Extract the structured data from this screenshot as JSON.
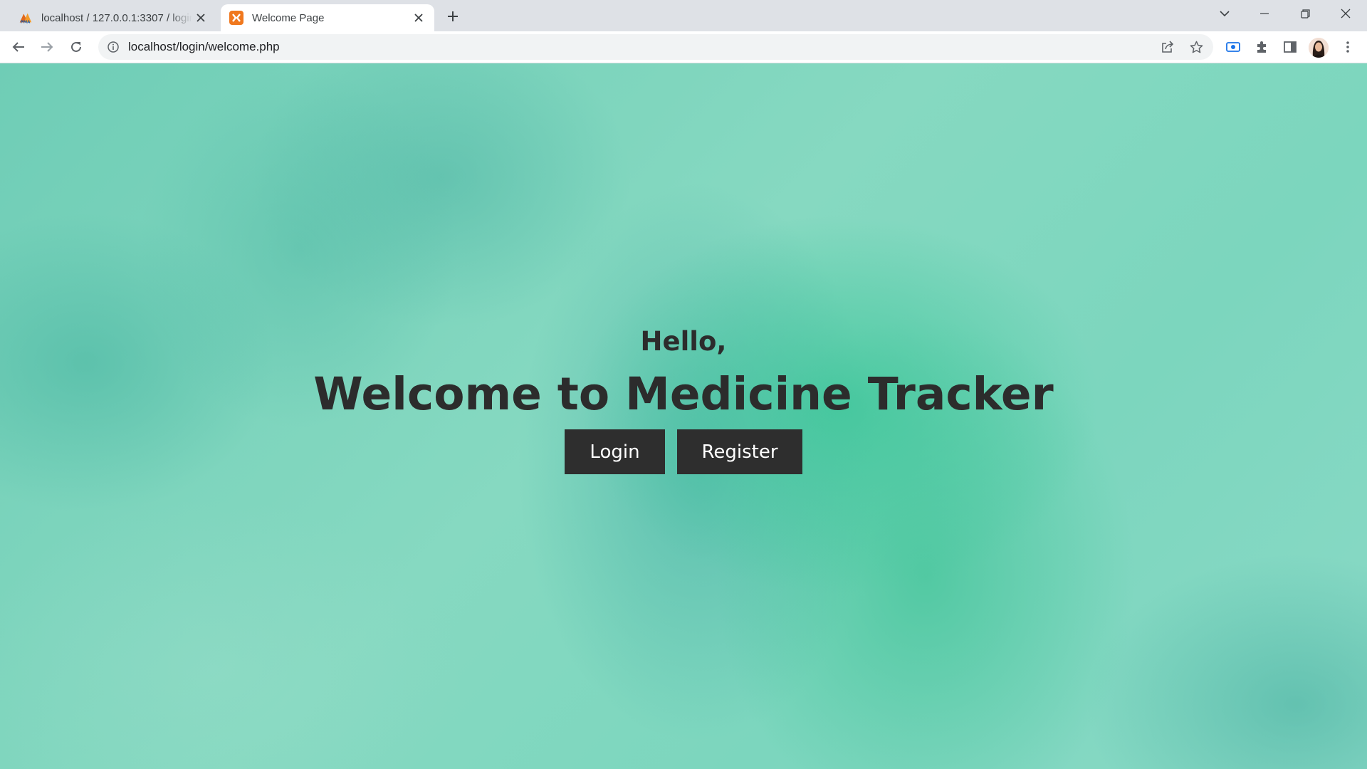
{
  "browser": {
    "tabs": [
      {
        "title": "localhost / 127.0.0.1:3307 / login",
        "favicon": "phpmyadmin-icon",
        "active": false
      },
      {
        "title": "Welcome Page",
        "favicon": "xampp-icon",
        "active": true
      }
    ],
    "address_bar": {
      "url": "localhost/login/welcome.php"
    },
    "toolbar_icons": [
      "back-icon",
      "forward-icon",
      "reload-icon",
      "info-icon",
      "share-icon",
      "star-icon",
      "screen-capture-icon",
      "extensions-icon",
      "side-panel-icon",
      "avatar",
      "menu-icon"
    ],
    "window_controls": [
      "tab-search-icon",
      "minimize-icon",
      "restore-icon",
      "close-icon"
    ]
  },
  "page": {
    "greeting": "Hello,",
    "headline": "Welcome to Medicine Tracker",
    "buttons": {
      "login": "Login",
      "register": "Register"
    },
    "colors": {
      "background_accent": "#6fcdb6",
      "text": "#2c2c2c",
      "button_bg": "#2e2e2e",
      "button_text": "#ffffff"
    }
  }
}
